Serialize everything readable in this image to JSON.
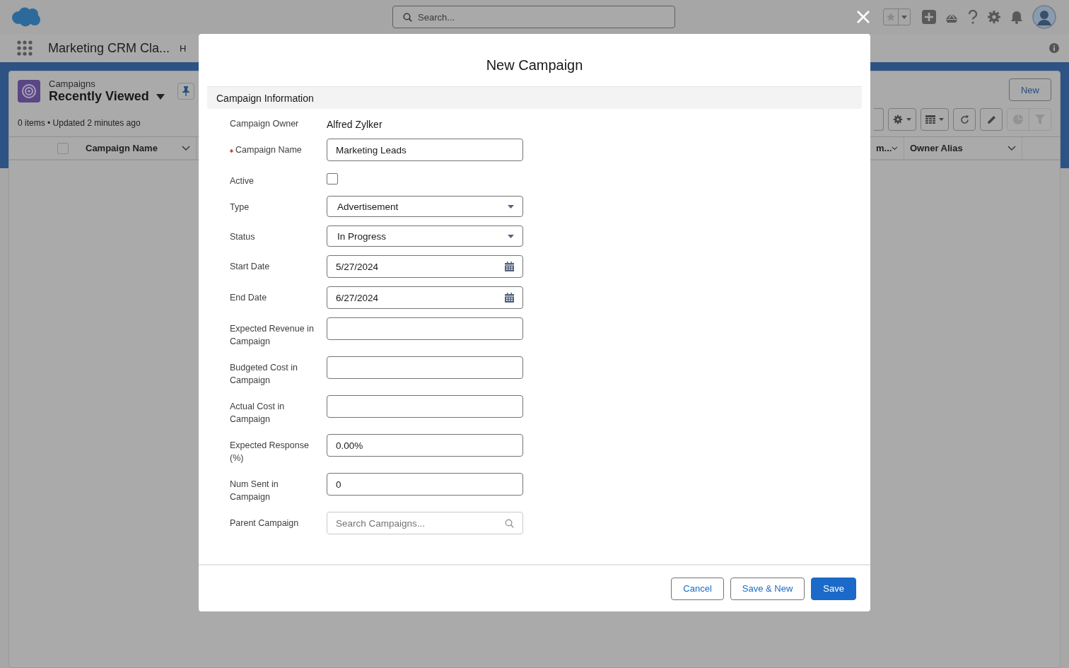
{
  "header": {
    "search": {
      "placeholder": "Search..."
    }
  },
  "app_nav": {
    "app_name": "Marketing CRM Cla...",
    "nav_items": [
      {
        "label": "H"
      }
    ]
  },
  "list_view": {
    "object_label": "Campaigns",
    "view_name": "Recently Viewed",
    "summary": "0 items • Updated 2 minutes ago",
    "new_button": "New",
    "select_all_checked": false,
    "columns": [
      {
        "label": "Campaign Name"
      },
      {
        "label": "m..."
      },
      {
        "label": "Owner Alias"
      }
    ]
  },
  "modal": {
    "title": "New Campaign",
    "section_title": "Campaign Information",
    "fields": [
      {
        "kind": "readonly",
        "label": "Campaign Owner",
        "value": "Alfred Zylker",
        "required": false
      },
      {
        "kind": "text",
        "label": "Campaign Name",
        "value": "Marketing Leads",
        "required": true
      },
      {
        "kind": "checkbox",
        "label": "Active",
        "checked": false,
        "required": false
      },
      {
        "kind": "picklist",
        "label": "Type",
        "value": "Advertisement",
        "required": false
      },
      {
        "kind": "picklist",
        "label": "Status",
        "value": "In Progress",
        "required": false
      },
      {
        "kind": "date",
        "label": "Start Date",
        "value": "5/27/2024",
        "required": false
      },
      {
        "kind": "date",
        "label": "End Date",
        "value": "6/27/2024",
        "required": false
      },
      {
        "kind": "text",
        "label": "Expected Revenue in Campaign",
        "required": false
      },
      {
        "kind": "text",
        "label": "Budgeted Cost in Campaign",
        "required": false
      },
      {
        "kind": "text",
        "label": "Actual Cost in Campaign",
        "required": false
      },
      {
        "kind": "text",
        "label": "Expected Response (%)",
        "value": "0.00%",
        "required": false
      },
      {
        "kind": "text",
        "label": "Num Sent in Campaign",
        "value": "0",
        "required": false
      },
      {
        "kind": "lookup",
        "label": "Parent Campaign",
        "placeholder": "Search Campaigns...",
        "required": false
      }
    ],
    "buttons": [
      {
        "label": "Cancel",
        "kind": "neutral"
      },
      {
        "label": "Save & New",
        "kind": "neutral"
      },
      {
        "label": "Save",
        "kind": "brand"
      }
    ]
  }
}
